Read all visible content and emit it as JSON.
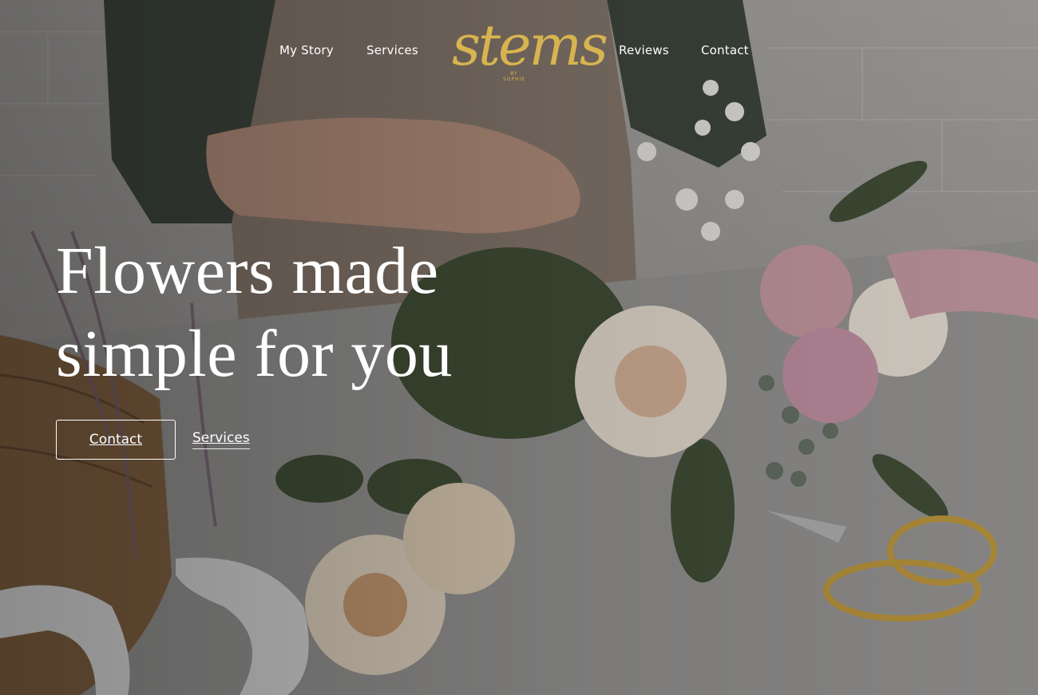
{
  "nav": {
    "items": [
      {
        "label": "My Story"
      },
      {
        "label": "Services"
      },
      {
        "label": "Reviews"
      },
      {
        "label": "Contact"
      }
    ],
    "logo": {
      "word": "stems",
      "sub": "BY SOPHIE"
    }
  },
  "hero": {
    "headline": "Flowers made simple for you",
    "contact_label": "Contact",
    "services_label": "Services"
  },
  "colors": {
    "accent_gold": "#d8b450",
    "text": "#ffffff"
  }
}
